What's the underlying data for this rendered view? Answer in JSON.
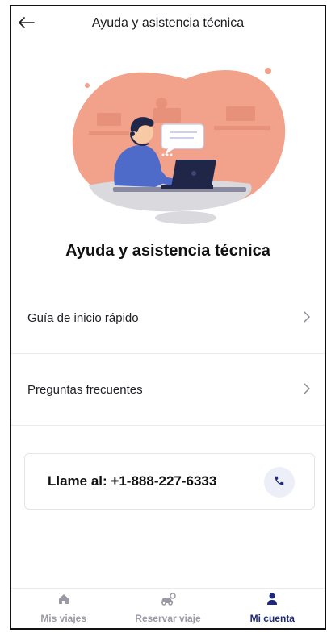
{
  "header": {
    "title": "Ayuda y asistencia técnica",
    "back_icon": "arrow-left-icon"
  },
  "page": {
    "title": "Ayuda y asistencia técnica"
  },
  "menu": [
    {
      "label": "Guía de inicio rápido",
      "icon": "chevron-right-icon"
    },
    {
      "label": "Preguntas frecuentes",
      "icon": "chevron-right-icon"
    }
  ],
  "call": {
    "label": "Llame al: +1-888-227-6333",
    "icon": "phone-icon"
  },
  "tabbar": {
    "items": [
      {
        "label": "Mis viajes",
        "icon": "home-icon",
        "active": false
      },
      {
        "label": "Reservar viaje",
        "icon": "car-icon",
        "active": false
      },
      {
        "label": "Mi cuenta",
        "icon": "person-icon",
        "active": true
      }
    ]
  },
  "colors": {
    "accent": "#1e2a78",
    "illustration_coral": "#f2a18a",
    "inactive": "#9a9aa4"
  }
}
